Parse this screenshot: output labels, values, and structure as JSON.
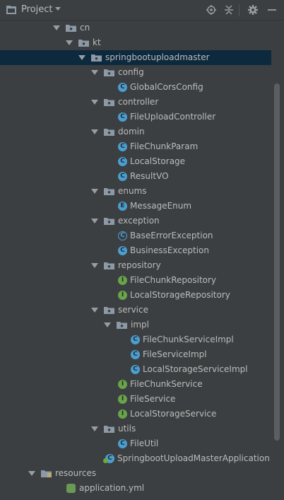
{
  "header": {
    "title": "Project",
    "icons": [
      "project-icon",
      "chevron-down-icon",
      "locate-icon",
      "collapse-all-icon",
      "gear-icon",
      "hide-icon"
    ]
  },
  "tree": {
    "items": [
      {
        "label": "cn",
        "kind": "package",
        "expanded": true
      },
      {
        "label": "kt",
        "kind": "package",
        "expanded": true
      },
      {
        "label": "springbootuploadmaster",
        "kind": "package",
        "expanded": true,
        "selected": true
      },
      {
        "label": "config",
        "kind": "package",
        "expanded": true
      },
      {
        "label": "GlobalCorsConfig",
        "kind": "class",
        "badge": "C"
      },
      {
        "label": "controller",
        "kind": "package",
        "expanded": true
      },
      {
        "label": "FileUploadController",
        "kind": "class",
        "badge": "C"
      },
      {
        "label": "domin",
        "kind": "package",
        "expanded": true
      },
      {
        "label": "FileChunkParam",
        "kind": "class",
        "badge": "C"
      },
      {
        "label": "LocalStorage",
        "kind": "class",
        "badge": "C"
      },
      {
        "label": "ResultVO",
        "kind": "class",
        "badge": "C"
      },
      {
        "label": "enums",
        "kind": "package",
        "expanded": true
      },
      {
        "label": "MessageEnum",
        "kind": "enum",
        "badge": "E"
      },
      {
        "label": "exception",
        "kind": "package",
        "expanded": true
      },
      {
        "label": "BaseErrorException",
        "kind": "abstract-class",
        "badge": "C"
      },
      {
        "label": "BusinessException",
        "kind": "class",
        "badge": "C"
      },
      {
        "label": "repository",
        "kind": "package",
        "expanded": true
      },
      {
        "label": "FileChunkRepository",
        "kind": "interface",
        "badge": "I"
      },
      {
        "label": "LocalStorageRepository",
        "kind": "interface",
        "badge": "I"
      },
      {
        "label": "service",
        "kind": "package",
        "expanded": true
      },
      {
        "label": "impl",
        "kind": "package",
        "expanded": true
      },
      {
        "label": "FileChunkServiceImpl",
        "kind": "class",
        "badge": "C"
      },
      {
        "label": "FileServiceImpl",
        "kind": "class",
        "badge": "C"
      },
      {
        "label": "LocalStorageServiceImpl",
        "kind": "class",
        "badge": "C"
      },
      {
        "label": "FileChunkService",
        "kind": "interface",
        "badge": "I"
      },
      {
        "label": "FileService",
        "kind": "interface",
        "badge": "I"
      },
      {
        "label": "LocalStorageService",
        "kind": "interface",
        "badge": "I"
      },
      {
        "label": "utils",
        "kind": "package",
        "expanded": true
      },
      {
        "label": "FileUtil",
        "kind": "class",
        "badge": "C"
      },
      {
        "label": "SpringbootUploadMasterApplication",
        "kind": "spring-app",
        "badge": "C"
      },
      {
        "label": "resources",
        "kind": "resources-folder",
        "expanded": true
      },
      {
        "label": "application.yml",
        "kind": "yml-file"
      }
    ]
  },
  "colors": {
    "background": "#3c3f41",
    "selection": "#0d293e",
    "class_badge": "#4a9fd2",
    "interface_badge": "#68a44a",
    "text": "#bbbbbb"
  }
}
